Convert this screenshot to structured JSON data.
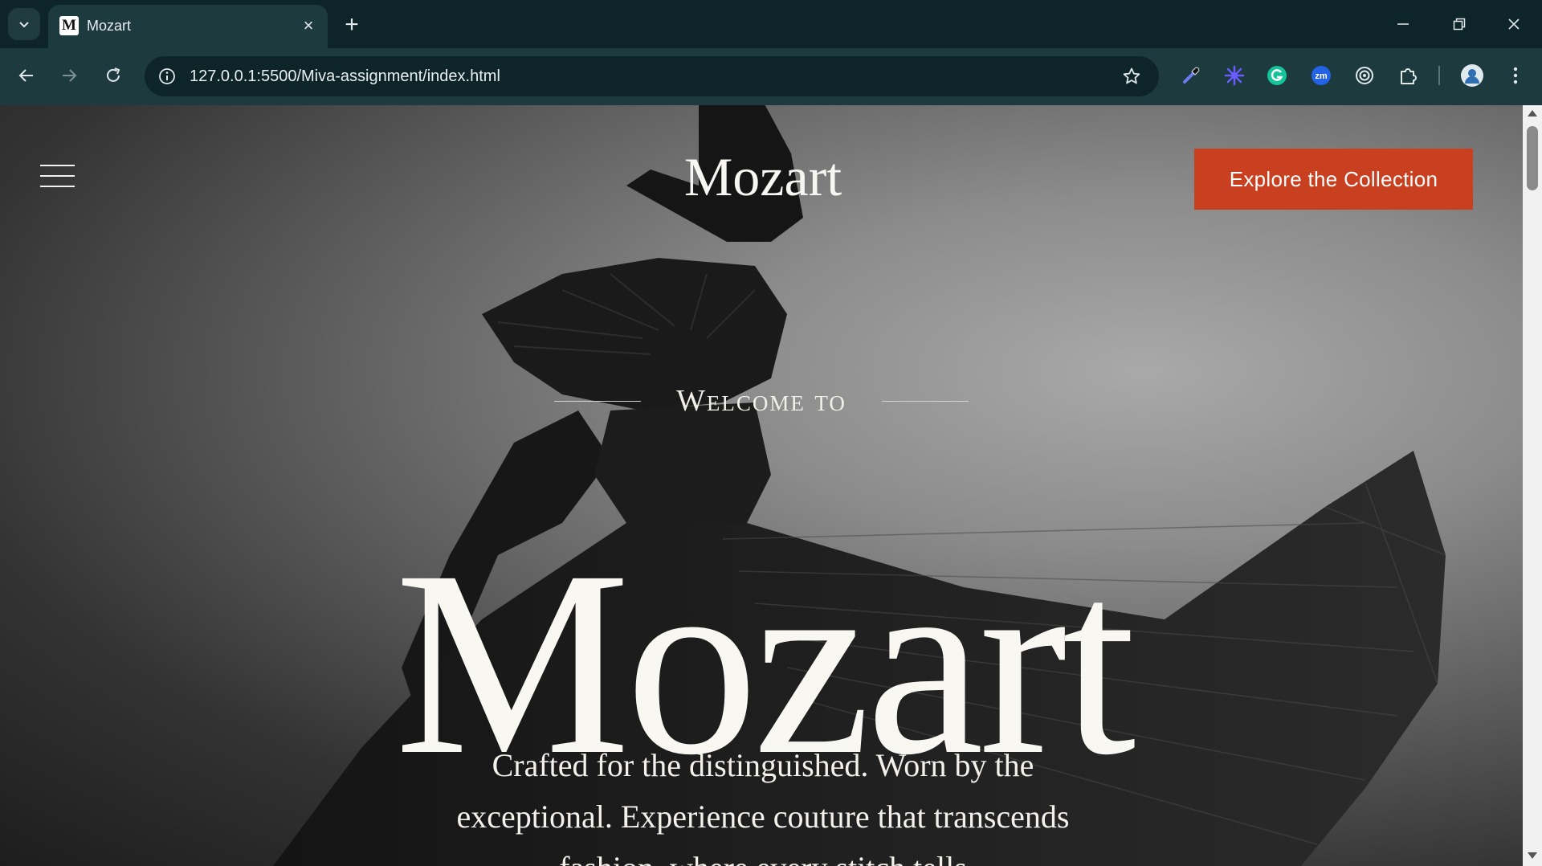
{
  "browser": {
    "tab_title": "Mozart",
    "tab_favicon_letter": "M",
    "url": "127.0.0.1:5500/Miva-assignment/index.html",
    "extensions": [
      "eyedropper-icon",
      "snowflake-extension-icon",
      "grammarly-icon",
      "zoom-icon",
      "target-extension-icon",
      "puzzle-icon"
    ],
    "colors": {
      "frame": "#0d2428",
      "toolbar": "#1d3a3f"
    }
  },
  "page": {
    "brand": "Mozart",
    "cta_label": "Explore the Collection",
    "welcome": "Welcome to",
    "hero_title": "Mozart",
    "tagline": "Crafted for the distinguished. Worn by the exceptional. Experience couture that transcends fashion, where every stitch tells",
    "colors": {
      "accent": "#c8401f",
      "text": "#f9f7f2"
    }
  }
}
